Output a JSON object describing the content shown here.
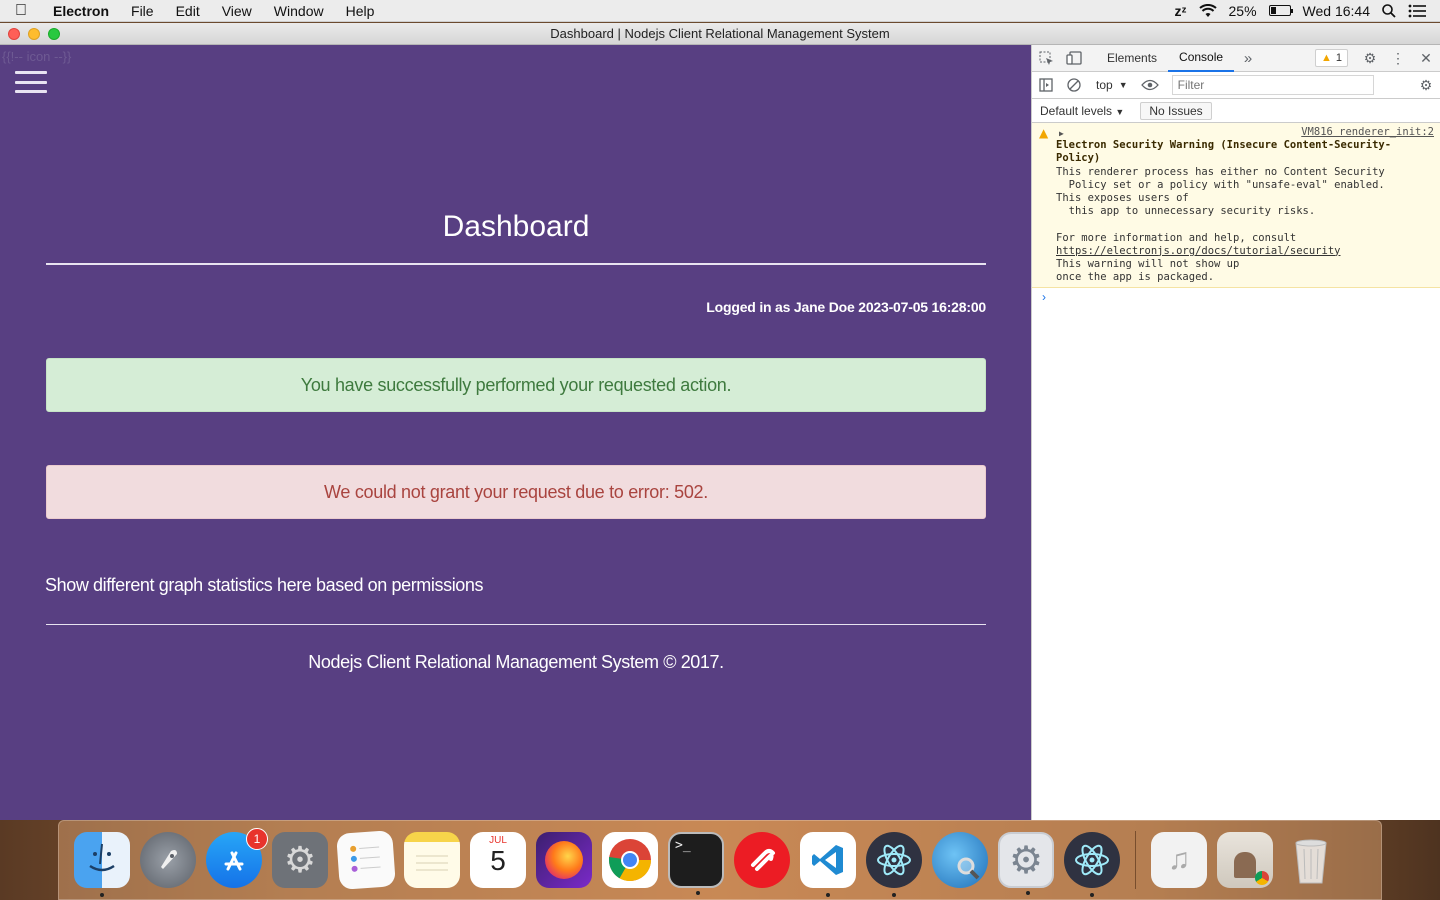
{
  "menubar": {
    "app_name": "Electron",
    "items": [
      "File",
      "Edit",
      "View",
      "Window",
      "Help"
    ],
    "battery": "25%",
    "clock": "Wed 16:44"
  },
  "window": {
    "title": "Dashboard | Nodejs Client Relational Management System"
  },
  "app": {
    "comment_text": "{{!-- icon --}}",
    "page_title": "Dashboard",
    "login_info": "Logged in as Jane Doe 2023-07-05 16:28:00",
    "success_alert": "You have successfully performed your requested action.",
    "error_alert": "We could not grant your request due to error: 502.",
    "graph_note": "Show different graph statistics here based on permissions",
    "footer": "Nodejs Client Relational Management System © 2017.",
    "colors": {
      "background": "#583f82",
      "success_bg": "#d5edd6",
      "success_text": "#3e7a3e",
      "error_bg": "#f1dcde",
      "error_text": "#a9443f"
    }
  },
  "devtools": {
    "tabs": [
      "Elements",
      "Console"
    ],
    "active_tab": "Console",
    "warning_count": "1",
    "context": "top",
    "filter_placeholder": "Filter",
    "levels": "Default levels",
    "issues": "No Issues",
    "message": {
      "source": "VM816 renderer_init:2",
      "heading": "Electron Security Warning (Insecure Content-Security-Policy)",
      "body": "This renderer process has either no Content Security\n  Policy set or a policy with \"unsafe-eval\" enabled.\nThis exposes users of\n  this app to unnecessary security risks.\n\nFor more information and help, consult",
      "link": "https://electronjs.org/docs/tutorial/security",
      "tail": "This warning will not show up\nonce the app is packaged."
    }
  },
  "dock": {
    "items": [
      {
        "name": "Finder",
        "icon": "finder-icon"
      },
      {
        "name": "Launchpad",
        "icon": "rocket-icon"
      },
      {
        "name": "App Store",
        "icon": "app-store-icon",
        "badge": "1"
      },
      {
        "name": "System Preferences",
        "icon": "gear-icon"
      },
      {
        "name": "Reminders",
        "icon": "reminders-icon"
      },
      {
        "name": "Notes",
        "icon": "notes-icon"
      },
      {
        "name": "Calendar",
        "icon": "calendar-icon",
        "month": "JUL",
        "day": "5"
      },
      {
        "name": "Firefox",
        "icon": "firefox-icon"
      },
      {
        "name": "Chrome",
        "icon": "chrome-icon"
      },
      {
        "name": "Terminal",
        "icon": "terminal-icon",
        "prompt": ">_"
      },
      {
        "name": "Authy",
        "icon": "authy-icon"
      },
      {
        "name": "VS Code",
        "icon": "vscode-icon"
      },
      {
        "name": "Electron",
        "icon": "electron-icon"
      },
      {
        "name": "Network Utility",
        "icon": "network-utility-icon"
      },
      {
        "name": "Preferences",
        "icon": "preferences-icon"
      },
      {
        "name": "Electron",
        "icon": "electron-icon"
      },
      {
        "name": "Music",
        "icon": "music-document-icon"
      },
      {
        "name": "Downloads",
        "icon": "downloads-stack-icon"
      },
      {
        "name": "Trash",
        "icon": "trash-icon"
      }
    ]
  }
}
